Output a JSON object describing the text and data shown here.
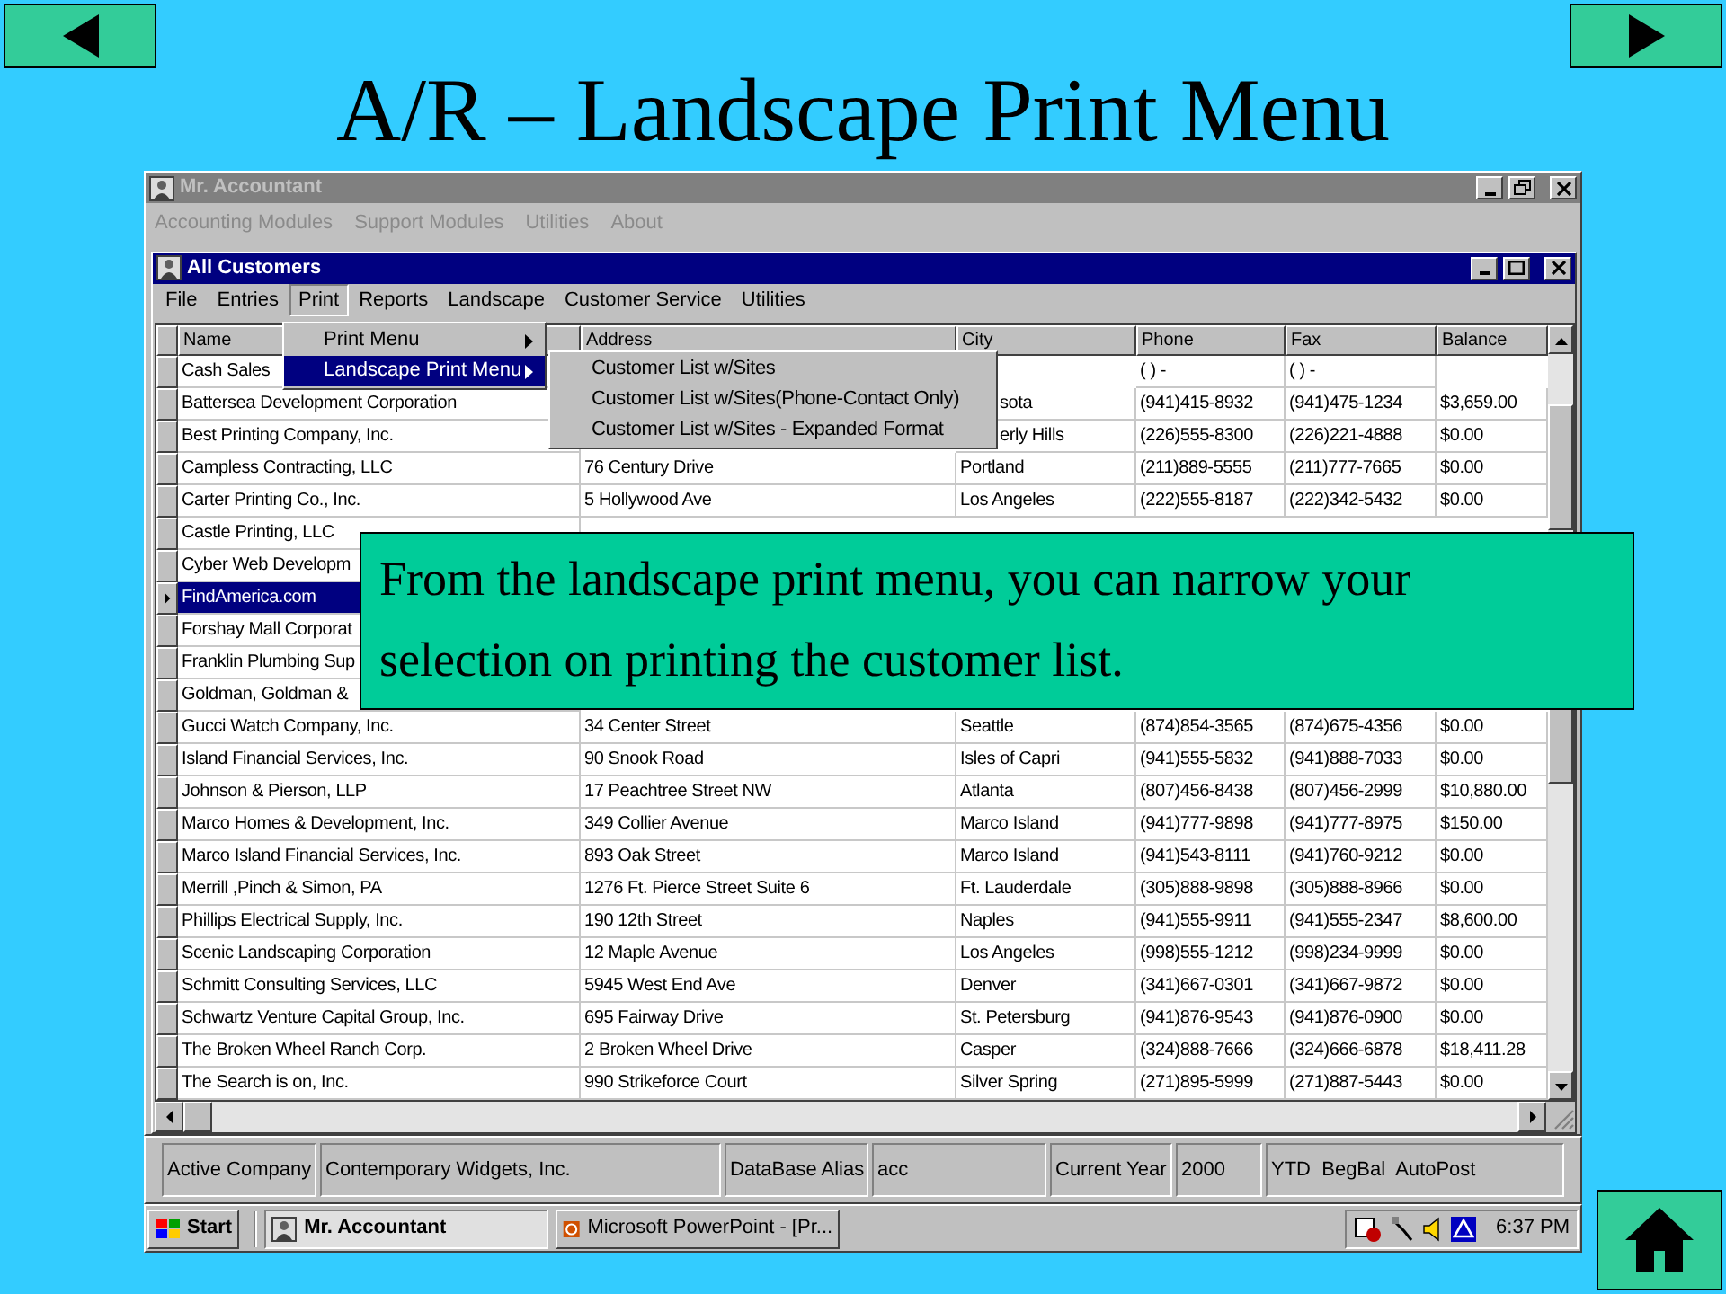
{
  "slide": {
    "title": "A/R – Landscape Print Menu",
    "callout": "From the landscape print menu, you can narrow your selection on printing the customer list."
  },
  "app": {
    "title": "Mr. Accountant",
    "menu": [
      {
        "label": "Accounting Modules",
        "disabled": true
      },
      {
        "label": "Support Modules",
        "disabled": true
      },
      {
        "label": "Utilities",
        "disabled": true
      },
      {
        "label": "About",
        "disabled": true
      }
    ]
  },
  "child": {
    "title": "All Customers",
    "menu": [
      {
        "label": "File",
        "selected": false
      },
      {
        "label": "Entries",
        "selected": false
      },
      {
        "label": "Print",
        "selected": true
      },
      {
        "label": "Reports",
        "selected": false
      },
      {
        "label": "Landscape",
        "selected": false
      },
      {
        "label": "Customer Service",
        "selected": false
      },
      {
        "label": "Utilities",
        "selected": false
      }
    ],
    "print_menu": [
      {
        "label": "Print Menu",
        "selected": false
      },
      {
        "label": "Landscape Print Menu",
        "selected": true
      }
    ],
    "submenu": [
      "Customer List w/Sites",
      "Customer List w/Sites(Phone-Contact Only)",
      "Customer List w/Sites - Expanded Format"
    ],
    "columns": [
      "Name",
      "Address",
      "City",
      "Phone",
      "Fax",
      "Balance"
    ],
    "rows": [
      {
        "name": "Cash Sales",
        "phone": "(   )   -",
        "fax": "(   )   -",
        "selected": false
      },
      {
        "name": "Battersea Development Corporation",
        "city": "sota",
        "phone": "(941)415-8932",
        "fax": "(941)475-1234",
        "balance": "$3,659.00",
        "selected": false
      },
      {
        "name": "Best Printing Company, Inc.",
        "city": "erly Hills",
        "phone": "(226)555-8300",
        "fax": "(226)221-4888",
        "balance": "$0.00",
        "selected": false
      },
      {
        "name": "Campless Contracting, LLC",
        "address": "76 Century Drive",
        "city": "Portland",
        "phone": "(211)889-5555",
        "fax": "(211)777-7665",
        "balance": "$0.00",
        "selected": false
      },
      {
        "name": "Carter Printing Co., Inc.",
        "address": "5 Hollywood Ave",
        "city": "Los Angeles",
        "phone": "(222)555-8187",
        "fax": "(222)342-5432",
        "balance": "$0.00",
        "selected": false
      },
      {
        "name": "Castle Printing, LLC",
        "selected": false
      },
      {
        "name": "Cyber Web Developm",
        "selected": false
      },
      {
        "name": "FindAmerica.com",
        "selected": true
      },
      {
        "name": "Forshay Mall Corporat",
        "selected": false
      },
      {
        "name": "Franklin Plumbing Sup",
        "selected": false
      },
      {
        "name": "Goldman, Goldman &",
        "selected": false
      },
      {
        "name": "Gucci Watch Company, Inc.",
        "address": "34 Center Street",
        "city": "Seattle",
        "phone": "(874)854-3565",
        "fax": "(874)675-4356",
        "balance": "$0.00",
        "selected": false
      },
      {
        "name": "Island Financial Services, Inc.",
        "address": "90 Snook Road",
        "city": "Isles of Capri",
        "phone": "(941)555-5832",
        "fax": "(941)888-7033",
        "balance": "$0.00",
        "selected": false
      },
      {
        "name": "Johnson & Pierson, LLP",
        "address": "17 Peachtree Street  NW",
        "city": "Atlanta",
        "phone": "(807)456-8438",
        "fax": "(807)456-2999",
        "balance": "$10,880.00",
        "selected": false
      },
      {
        "name": "Marco Homes & Development, Inc.",
        "address": "349 Collier Avenue",
        "city": "Marco Island",
        "phone": "(941)777-9898",
        "fax": "(941)777-8975",
        "balance": "$150.00",
        "selected": false
      },
      {
        "name": "Marco Island Financial Services, Inc.",
        "address": "893 Oak Street",
        "city": "Marco Island",
        "phone": "(941)543-8111",
        "fax": "(941)760-9212",
        "balance": "$0.00",
        "selected": false
      },
      {
        "name": "Merrill ,Pinch & Simon, PA",
        "address": "1276 Ft. Pierce Street  Suite 6",
        "city": "Ft. Lauderdale",
        "phone": "(305)888-9898",
        "fax": "(305)888-8966",
        "balance": "$0.00",
        "selected": false
      },
      {
        "name": "Phillips Electrical Supply, Inc.",
        "address": "190 12th Street",
        "city": "Naples",
        "phone": "(941)555-9911",
        "fax": "(941)555-2347",
        "balance": "$8,600.00",
        "selected": false
      },
      {
        "name": "Scenic Landscaping Corporation",
        "address": "12 Maple Avenue",
        "city": "Los Angeles",
        "phone": "(998)555-1212",
        "fax": "(998)234-9999",
        "balance": "$0.00",
        "selected": false
      },
      {
        "name": "Schmitt Consulting Services, LLC",
        "address": "5945 West End Ave",
        "city": "Denver",
        "phone": "(341)667-0301",
        "fax": "(341)667-9872",
        "balance": "$0.00",
        "selected": false
      },
      {
        "name": "Schwartz Venture Capital Group, Inc.",
        "address": "695 Fairway Drive",
        "city": "St. Petersburg",
        "phone": "(941)876-9543",
        "fax": "(941)876-0900",
        "balance": "$0.00",
        "selected": false
      },
      {
        "name": "The Broken Wheel Ranch Corp.",
        "address": "2 Broken Wheel Drive",
        "city": "Casper",
        "phone": "(324)888-7666",
        "fax": "(324)666-6878",
        "balance": "$18,411.28",
        "selected": false
      },
      {
        "name": "The Search is on, Inc.",
        "address": "990 Strikeforce Court",
        "city": "Silver Spring",
        "phone": "(271)895-5999",
        "fax": "(271)887-5443",
        "balance": "$0.00",
        "selected": false
      }
    ]
  },
  "status_bar": [
    "Active Company",
    "Contemporary Widgets, Inc.",
    "DataBase Alias",
    "acc",
    "Current Year",
    "2000",
    "YTD  BegBal  AutoPost"
  ],
  "taskbar": {
    "start": "Start",
    "tasks": [
      {
        "label": "Mr. Accountant",
        "selected": true
      },
      {
        "label": "Microsoft PowerPoint - [Pr...",
        "selected": false
      }
    ],
    "clock": "6:37 PM"
  }
}
